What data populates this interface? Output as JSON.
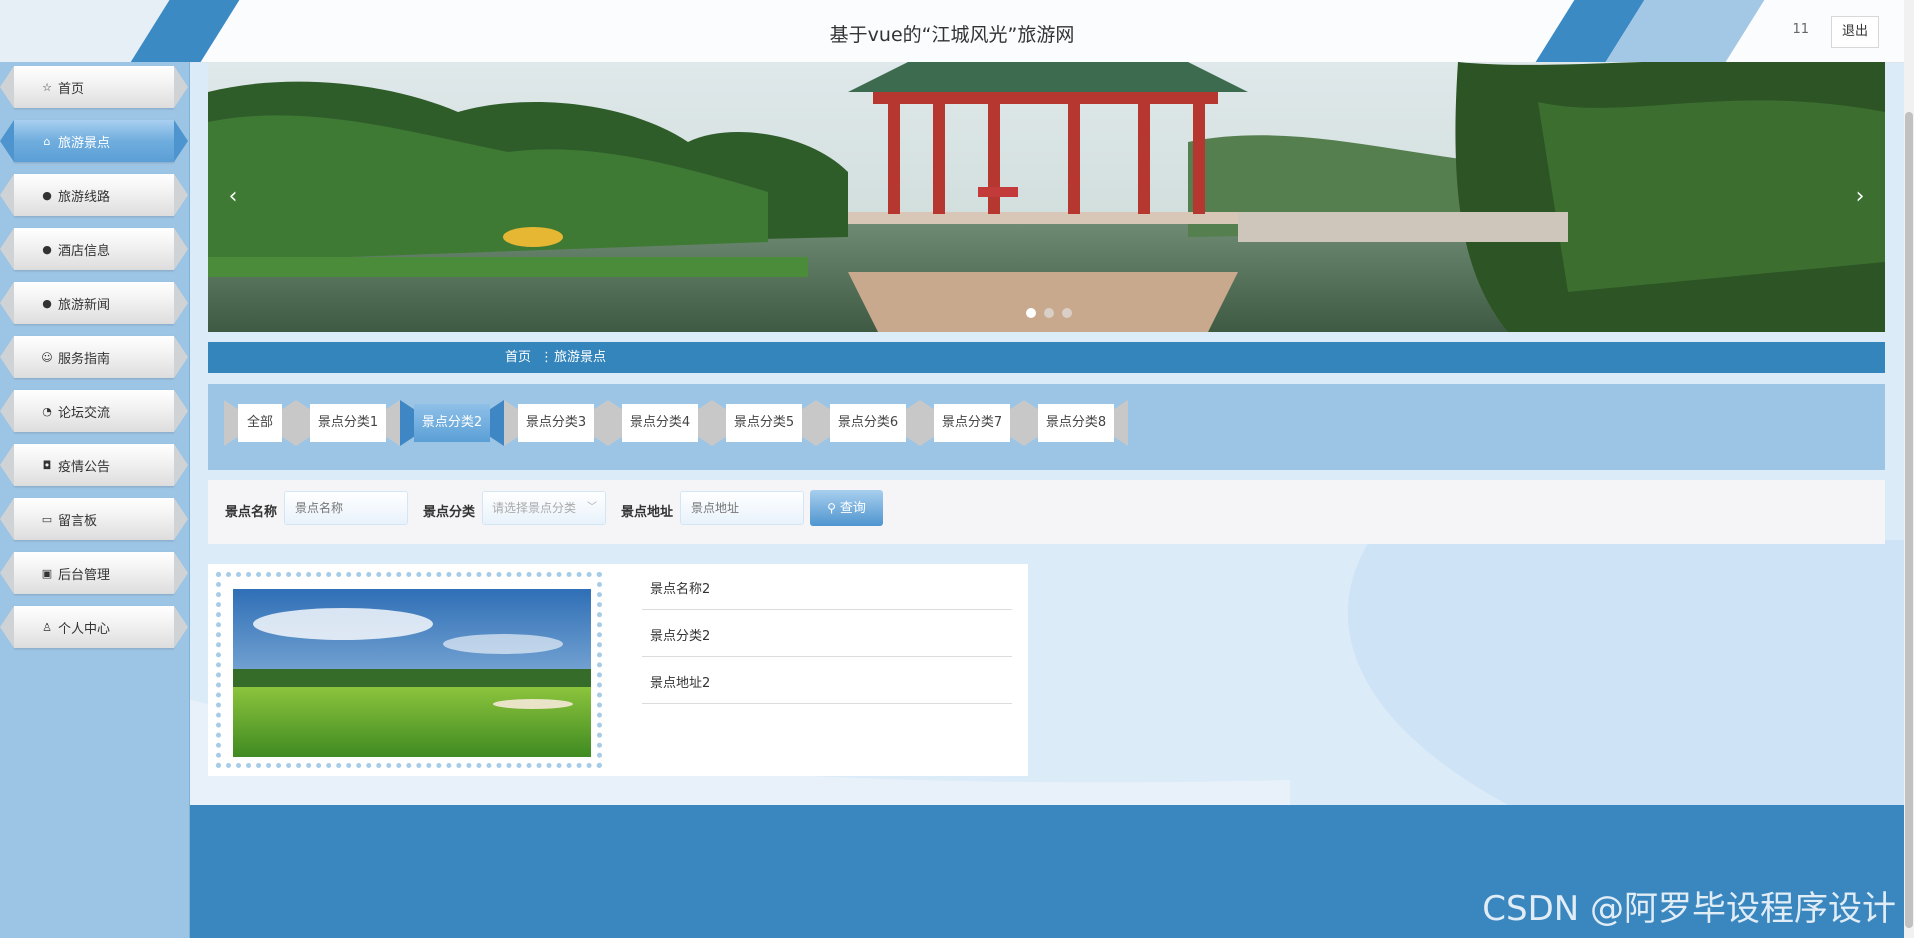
{
  "header": {
    "title": "基于vue的“江城风光”旅游网",
    "user_number": "11",
    "logout_label": "退出"
  },
  "sidebar": {
    "items": [
      {
        "label": "首页",
        "icon": "star-icon",
        "glyph": "☆"
      },
      {
        "label": "旅游景点",
        "icon": "bag-icon",
        "glyph": "⌂",
        "active": true
      },
      {
        "label": "旅游线路",
        "icon": "alert-icon",
        "glyph": "●"
      },
      {
        "label": "酒店信息",
        "icon": "help-icon",
        "glyph": "●"
      },
      {
        "label": "旅游新闻",
        "icon": "info-icon",
        "glyph": "●"
      },
      {
        "label": "服务指南",
        "icon": "smile-icon",
        "glyph": "☺"
      },
      {
        "label": "论坛交流",
        "icon": "chat-icon",
        "glyph": "◔"
      },
      {
        "label": "疫情公告",
        "icon": "camera-icon",
        "glyph": "◘"
      },
      {
        "label": "留言板",
        "icon": "printer-icon",
        "glyph": "▭"
      },
      {
        "label": "后台管理",
        "icon": "briefcase-icon",
        "glyph": "▣"
      },
      {
        "label": "个人中心",
        "icon": "user-icon",
        "glyph": "♙"
      }
    ]
  },
  "banner": {
    "prev_glyph": "‹",
    "next_glyph": "›",
    "active_slide": 1,
    "slide_count": 3
  },
  "breadcrumb": {
    "home": "首页",
    "separator": "⋮",
    "current": "旅游景点"
  },
  "categories": {
    "tabs": [
      "全部",
      "景点分类1",
      "景点分类2",
      "景点分类3",
      "景点分类4",
      "景点分类5",
      "景点分类6",
      "景点分类7",
      "景点分类8"
    ],
    "active_index": 2
  },
  "search": {
    "name_label": "景点名称",
    "name_placeholder": "景点名称",
    "category_label": "景点分类",
    "category_placeholder": "请选择景点分类",
    "address_label": "景点地址",
    "address_placeholder": "景点地址",
    "query_label": "查询"
  },
  "listing": {
    "name": "景点名称2",
    "category": "景点分类2",
    "address": "景点地址2"
  },
  "watermark": "CSDN @阿罗毕设程序设计",
  "colors": {
    "primary": "#3585bd",
    "sidebar_bg": "#9cc4e4",
    "accent": "#5b9fd6"
  }
}
